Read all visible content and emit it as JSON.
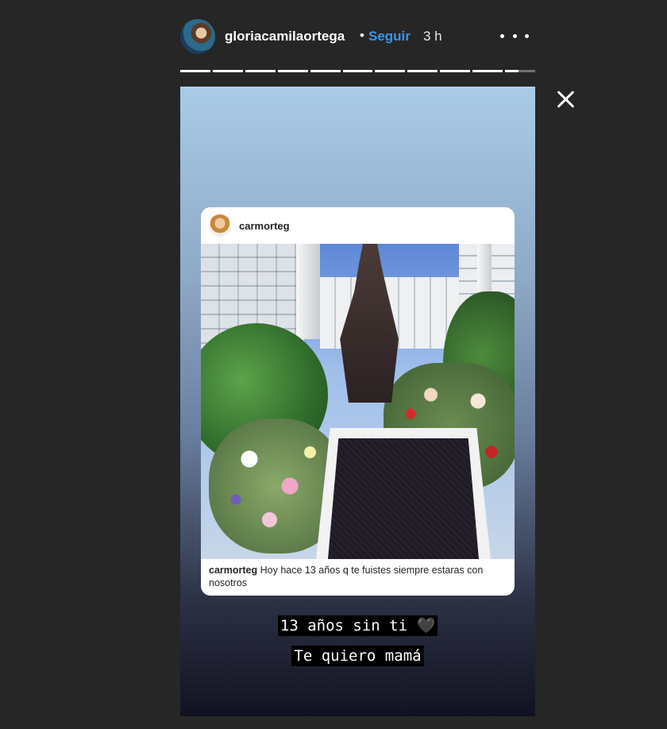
{
  "header": {
    "username": "gloriacamilaortega",
    "separator": "•",
    "follow_label": "Seguir",
    "time": "3 h"
  },
  "progress_segments": 11,
  "shared_post": {
    "username": "carmorteg",
    "caption_user": "carmorteg",
    "caption_text": " Hoy hace 13 años q te fuistes siempre estaras con nosotros"
  },
  "stickers": {
    "line1": "13 años sin ti 🖤",
    "line2": "Te quiero mamá"
  },
  "icons": {
    "more": "more-dots-icon",
    "close": "close-icon"
  },
  "colors": {
    "background": "#262626",
    "follow": "#3897f0"
  }
}
